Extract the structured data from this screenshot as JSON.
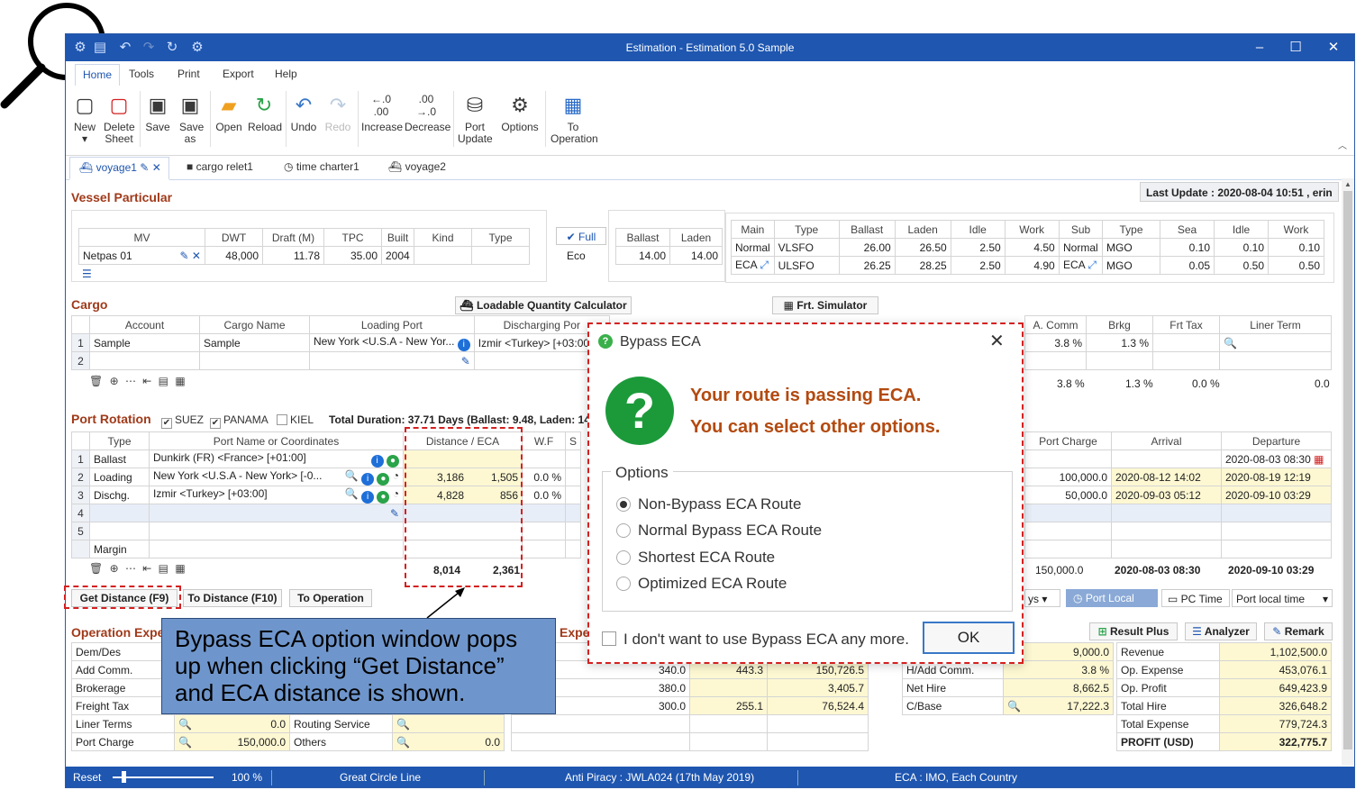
{
  "window": {
    "title": "Estimation - Estimation 5.0 Sample",
    "menu": [
      "Home",
      "Tools",
      "Print",
      "Export",
      "Help"
    ]
  },
  "ribbon": {
    "buttons": [
      {
        "label": "New",
        "icon": "new-sheet-icon"
      },
      {
        "label": "Delete Sheet",
        "icon": "delete-sheet-icon"
      },
      {
        "label": "Save",
        "icon": "save-icon"
      },
      {
        "label": "Save as",
        "icon": "save-as-icon"
      },
      {
        "label": "Open",
        "icon": "folder-open-icon"
      },
      {
        "label": "Reload",
        "icon": "reload-icon"
      },
      {
        "label": "Undo",
        "icon": "undo-icon"
      },
      {
        "label": "Redo",
        "icon": "redo-icon"
      },
      {
        "label": "Increase",
        "icon": "increase-decimal-icon"
      },
      {
        "label": "Decrease",
        "icon": "decrease-decimal-icon"
      },
      {
        "label": "Port Update",
        "icon": "port-update-icon"
      },
      {
        "label": "Options",
        "icon": "gear-icon"
      },
      {
        "label": "To Operation",
        "icon": "to-operation-icon"
      }
    ]
  },
  "tabs": [
    "voyage1",
    "cargo relet1",
    "time charter1",
    "voyage2"
  ],
  "last_update": "Last Update : 2020-08-04 10:51 , erin",
  "vessel": {
    "section": "Vessel Particular",
    "headers": [
      "MV",
      "DWT",
      "Draft (M)",
      "TPC",
      "Built",
      "Kind",
      "Type"
    ],
    "row": [
      "Netpas 01",
      "48,000",
      "11.78",
      "35.00",
      "2004",
      "",
      ""
    ],
    "full_label": "Full",
    "eco_label": "Eco",
    "speed_headers": [
      "Ballast",
      "Laden"
    ],
    "speed_row": [
      "14.00",
      "14.00"
    ],
    "main_headers": [
      "Main",
      "Type",
      "Ballast",
      "Laden",
      "Idle",
      "Work"
    ],
    "main_rows": [
      [
        "Normal",
        "VLSFO",
        "26.00",
        "26.50",
        "2.50",
        "4.50"
      ],
      [
        "ECA",
        "ULSFO",
        "26.25",
        "28.25",
        "2.50",
        "4.90"
      ]
    ],
    "sub_headers": [
      "Sub",
      "Type",
      "Sea",
      "Idle",
      "Work"
    ],
    "sub_rows": [
      [
        "Normal",
        "MGO",
        "0.10",
        "0.10",
        "0.10"
      ],
      [
        "ECA",
        "MGO",
        "0.05",
        "0.50",
        "0.50"
      ]
    ]
  },
  "cargo": {
    "section": "Cargo",
    "loadable_btn": "Loadable Quantity Calculator",
    "frt_btn": "Frt. Simulator",
    "headers": [
      "Account",
      "Cargo Name",
      "Loading Port",
      "Discharging Por"
    ],
    "right_headers": [
      "A. Comm",
      "Brkg",
      "Frt Tax",
      "Liner Term"
    ],
    "rows": [
      {
        "n": "1",
        "account": "Sample",
        "cargo": "Sample",
        "load": "New York <U.S.A - New Yor...",
        "disch": "Izmir <Turkey> [+03:00]",
        "acomm": "3.8 %",
        "brkg": "1.3 %",
        "frttax": "",
        "liner": ""
      },
      {
        "n": "2",
        "account": "",
        "cargo": "",
        "load": "",
        "disch": "",
        "acomm": "",
        "brkg": "",
        "frttax": "",
        "liner": ""
      }
    ],
    "totals": {
      "acomm": "3.8 %",
      "brkg": "1.3 %",
      "frttax": "0.0 %",
      "liner": "0.0"
    }
  },
  "port_rotation": {
    "section": "Port Rotation",
    "suez": "SUEZ",
    "panama": "PANAMA",
    "kiel": "KIEL",
    "duration": "Total Duration: 37.71 Days (Ballast: 9.48, Laden: 14.3",
    "headers": [
      "Type",
      "Port Name or Coordinates",
      "Distance / ECA",
      "W.F",
      "S"
    ],
    "right_headers": [
      "Port Charge",
      "Arrival",
      "Departure"
    ],
    "rows": [
      {
        "n": "1",
        "type": "Ballast",
        "port": "Dunkirk (FR) <France> [+01:00]",
        "dist": "",
        "eca": "",
        "wf": "",
        "charge": "",
        "arrival": "",
        "departure": "2020-08-03 08:30"
      },
      {
        "n": "2",
        "type": "Loading",
        "port": "New York <U.S.A - New York> [-0...",
        "dist": "3,186",
        "eca": "1,505",
        "wf": "0.0 %",
        "charge": "100,000.0",
        "arrival": "2020-08-12 14:02",
        "departure": "2020-08-19 12:19"
      },
      {
        "n": "3",
        "type": "Dischg.",
        "port": "Izmir <Turkey> [+03:00]",
        "dist": "4,828",
        "eca": "856",
        "wf": "0.0 %",
        "charge": "50,000.0",
        "arrival": "2020-09-03 05:12",
        "departure": "2020-09-10 03:29"
      },
      {
        "n": "4",
        "type": "",
        "port": "",
        "dist": "",
        "eca": "",
        "wf": "",
        "charge": "",
        "arrival": "",
        "departure": ""
      },
      {
        "n": "5",
        "type": "",
        "port": "",
        "dist": "",
        "eca": "",
        "wf": "",
        "charge": "",
        "arrival": "",
        "departure": ""
      },
      {
        "n": "",
        "type": "Margin",
        "port": "",
        "dist": "",
        "eca": "",
        "wf": "",
        "charge": "",
        "arrival": "",
        "departure": ""
      }
    ],
    "totals": {
      "dist": "8,014",
      "eca": "2,361",
      "charge": "150,000.0",
      "arrival": "2020-08-03 08:30",
      "departure": "2020-09-10 03:29"
    },
    "get_distance": "Get Distance (F9)",
    "to_distance": "To Distance (F10)",
    "to_operation": "To Operation",
    "ys": "ys",
    "port_local": "Port Local",
    "pc_time": "PC Time",
    "port_local_time": "Port local time"
  },
  "operation": {
    "section": "Operation Expe",
    "section2": "Expe",
    "result_plus": "Result Plus",
    "analyzer": "Analyzer",
    "remark": "Remark",
    "left_rows": [
      {
        "label": "Dem/Des",
        "value": ""
      },
      {
        "label": "Add Comm.",
        "value": ""
      },
      {
        "label": "Brokerage",
        "value": ""
      },
      {
        "label": "Freight Tax",
        "value": ""
      },
      {
        "label": "Liner Terms",
        "value": "0.0"
      },
      {
        "label": "Port Charge",
        "value": "150,000.0"
      }
    ],
    "mid_rows": [
      {
        "label": "Routing Service",
        "value": ""
      },
      {
        "label": "Others",
        "value": "0.0"
      }
    ],
    "center_rows": [
      [
        "",
        "",
        ""
      ],
      [
        "340.0",
        "443.3",
        "150,726.5"
      ],
      [
        "380.0",
        "",
        "3,405.7"
      ],
      [
        "300.0",
        "255.1",
        "76,524.4"
      ]
    ],
    "hire_rows": [
      {
        "label": "",
        "value": "9,000.0"
      },
      {
        "label": "H/Add Comm.",
        "value": "3.8 %"
      },
      {
        "label": "Net Hire",
        "value": "8,662.5"
      },
      {
        "label": "C/Base",
        "value": "17,222.3"
      }
    ],
    "result_rows": [
      {
        "label": "Revenue",
        "value": "1,102,500.0"
      },
      {
        "label": "Op. Expense",
        "value": "453,076.1"
      },
      {
        "label": "Op. Profit",
        "value": "649,423.9"
      },
      {
        "label": "Total Hire",
        "value": "326,648.2"
      },
      {
        "label": "Total Expense",
        "value": "779,724.3"
      },
      {
        "label": "PROFIT (USD)",
        "value": "322,775.7"
      }
    ]
  },
  "status": {
    "reset": "Reset",
    "zoom": "100 %",
    "route": "Great Circle Line",
    "piracy": "Anti Piracy : JWLA024 (17th May 2019)",
    "eca": "ECA : IMO, Each Country"
  },
  "dialog": {
    "title": "Bypass ECA",
    "message1": "Your route is passing ECA.",
    "message2": "You can select other options.",
    "options_label": "Options",
    "options": [
      "Non-Bypass ECA Route",
      "Normal Bypass ECA Route",
      "Shortest ECA Route",
      "Optimized ECA Route"
    ],
    "selected": 0,
    "dont_show": "I don't want to use Bypass ECA any more.",
    "ok": "OK"
  },
  "callout": {
    "text": "Bypass ECA option window pops up when clicking “Get Distance” and ECA distance is shown."
  },
  "colors": {
    "title_bar": "#1e56b0",
    "section_title": "#a03a1a",
    "annotation_red": "#d42020",
    "callout_blue": "#6f96cc",
    "dialog_green": "#1c9a3a",
    "dialog_message": "#b34a10"
  }
}
